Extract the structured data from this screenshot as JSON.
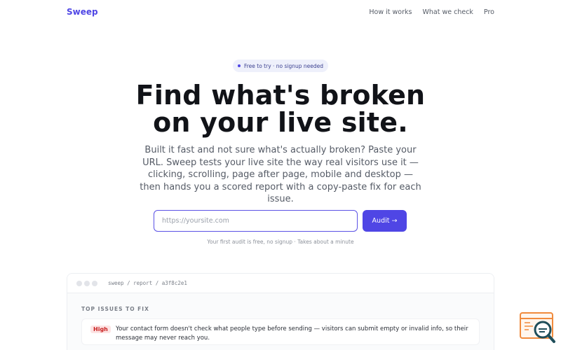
{
  "nav": {
    "brand": "Sweep",
    "links": [
      "How it works",
      "What we check",
      "Pro"
    ]
  },
  "hero": {
    "badge": "Free to try · no signup needed",
    "headline_line1": "Find what's broken",
    "headline_line2": "on your live site.",
    "subtitle": "Built it fast and not sure what's actually broken? Paste your URL. Sweep tests your live site the way real visitors use it — clicking, scrolling, page after page, mobile and desktop — then hands you a scored report with a copy-paste fix for each issue.",
    "input_placeholder": "https://yoursite.com",
    "input_value": "",
    "button_label": "Audit →",
    "note": "Your first audit is free, no signup · Takes about a minute"
  },
  "report": {
    "path": "sweep / report / a3f8c2e1",
    "section_title": "TOP ISSUES TO FIX",
    "issues": [
      {
        "severity": "High",
        "text": "Your contact form doesn't check what people type before sending — visitors can submit empty or invalid info, so their message may never reach you."
      }
    ]
  },
  "colors": {
    "accent": "#4f46e5",
    "severity_high_bg": "#fde4e4",
    "severity_high_text": "#c81e1e",
    "fab_orange": "#f08a3c",
    "fab_teal": "#1f4e5a"
  },
  "icons": {
    "fab": "browser-magnifier-icon"
  }
}
